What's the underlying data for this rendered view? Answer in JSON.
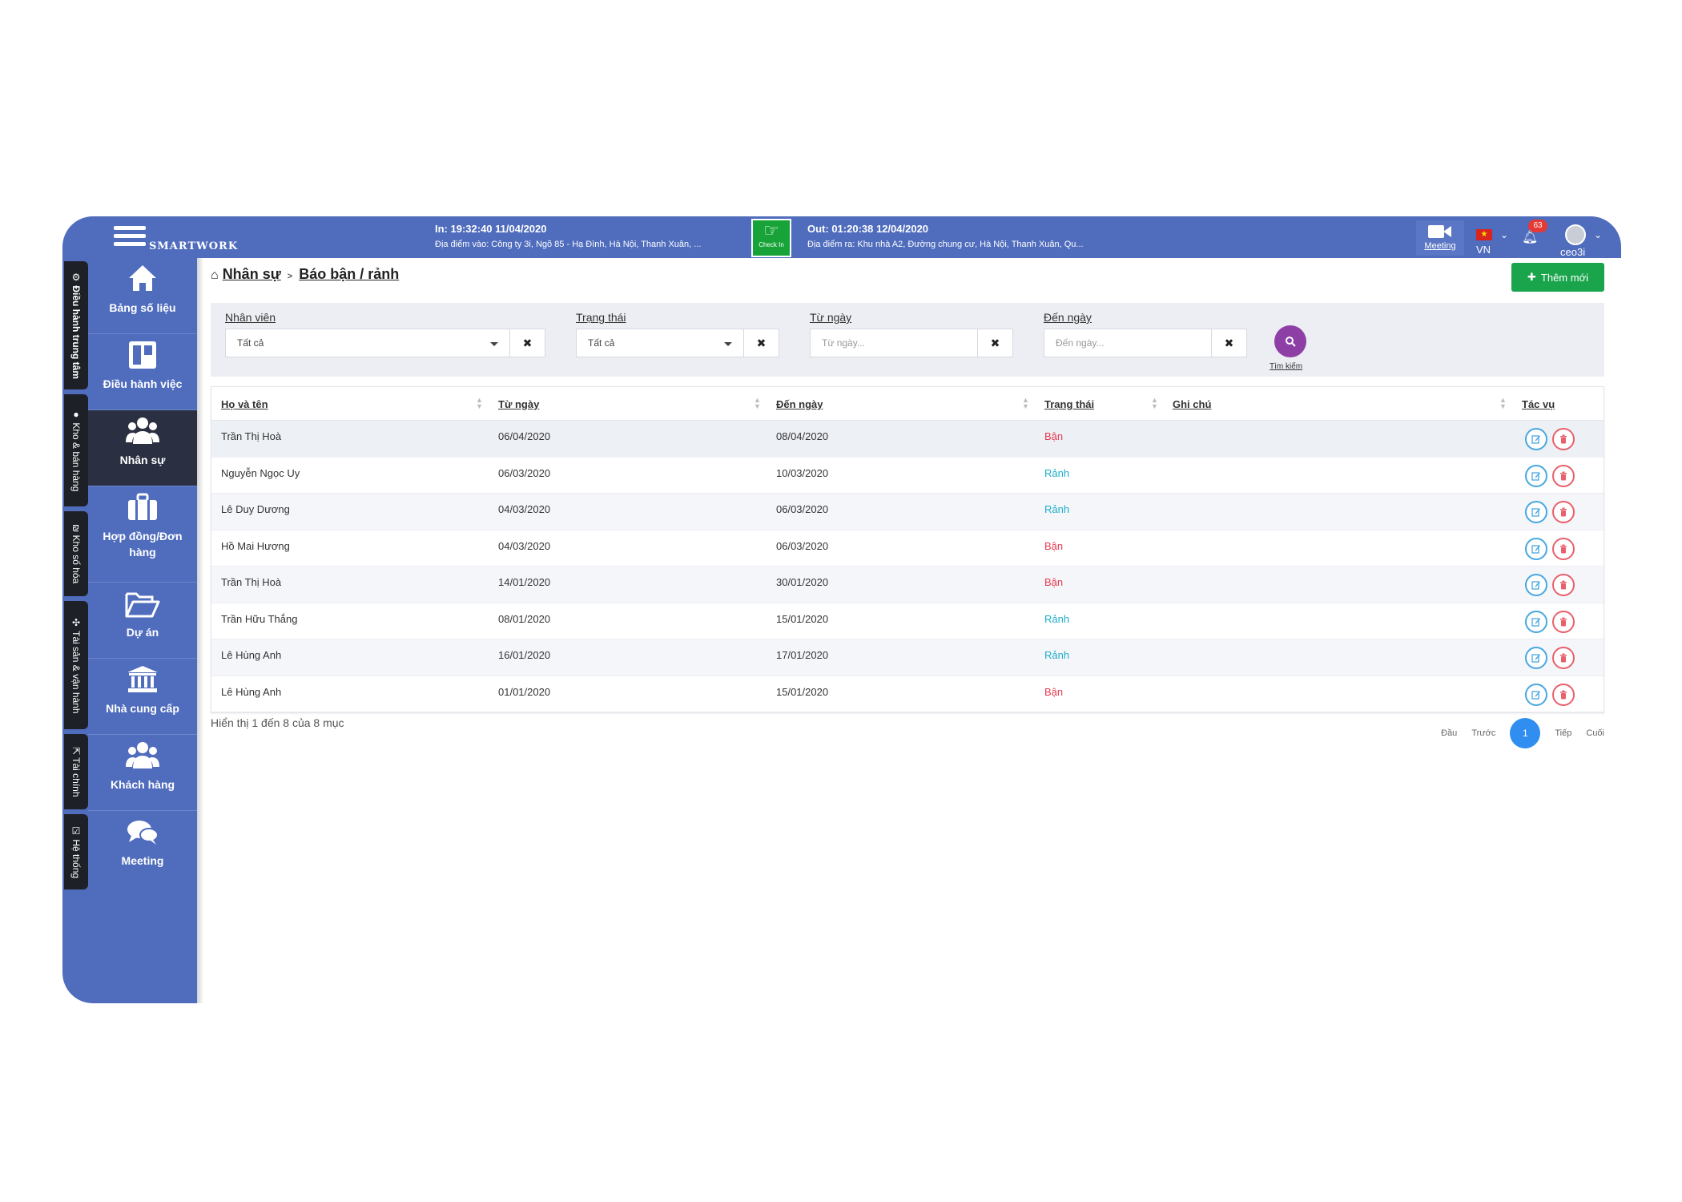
{
  "header": {
    "logo": "SMARTWORK",
    "checkin": {
      "in_time": "In: 19:32:40 11/04/2020",
      "in_location": "Địa điểm vào: Công ty 3i, Ngõ 85 - Hạ Đình, Hà Nội, Thanh Xuân, ...",
      "button_label": "Check In",
      "out_time": "Out: 01:20:38 12/04/2020",
      "out_location": "Địa điểm ra: Khu nhà A2, Đường chung cư, Hà Nội, Thanh Xuân, Qu..."
    },
    "meeting_label": "Meeting",
    "language": "VN",
    "notification_count": "63",
    "username": "ceo3i"
  },
  "modules": [
    "⚙ Điều hành trung tâm",
    "● Kho & bán hàng",
    "₪ Kho số hóa",
    "✣ Tài sản & vận hành",
    "⇱ Tài chính",
    "☑ Hệ thống"
  ],
  "sidebar": {
    "items": [
      {
        "label": "Bảng số liệu",
        "icon": "home-icon"
      },
      {
        "label": "Điều hành việc",
        "icon": "board-icon"
      },
      {
        "label": "Nhân sự",
        "icon": "users-icon"
      },
      {
        "label": "Hợp đồng/Đơn hàng",
        "icon": "briefcase-icon"
      },
      {
        "label": "Dự án",
        "icon": "folder-open-icon"
      },
      {
        "label": "Nhà cung cấp",
        "icon": "bank-icon"
      },
      {
        "label": "Khách hàng",
        "icon": "users-icon"
      },
      {
        "label": "Meeting",
        "icon": "chat-icon"
      }
    ]
  },
  "breadcrumb": {
    "parent": "Nhân sự",
    "current": "Báo bận / rảnh"
  },
  "add_button": "Thêm mới",
  "filters": {
    "employee": {
      "label": "Nhân viên",
      "value": "Tất cả"
    },
    "status": {
      "label": "Trạng thái",
      "value": "Tất cả"
    },
    "from_date": {
      "label": "Từ ngày",
      "placeholder": "Từ ngày..."
    },
    "to_date": {
      "label": "Đến ngày",
      "placeholder": "Đến ngày..."
    },
    "search_label": "Tìm kiếm"
  },
  "table": {
    "columns": [
      "Họ và tên",
      "Từ ngày",
      "Đến ngày",
      "Trạng thái",
      "Ghi chú",
      "Tác vụ"
    ],
    "rows": [
      {
        "name": "Trần Thị Hoà",
        "from": "06/04/2020",
        "to": "08/04/2020",
        "status": "Bận",
        "note": ""
      },
      {
        "name": "Nguyễn Ngọc Uy",
        "from": "06/03/2020",
        "to": "10/03/2020",
        "status": "Rảnh",
        "note": ""
      },
      {
        "name": "Lê Duy Dương",
        "from": "04/03/2020",
        "to": "06/03/2020",
        "status": "Rảnh",
        "note": ""
      },
      {
        "name": "Hồ Mai Hương",
        "from": "04/03/2020",
        "to": "06/03/2020",
        "status": "Bận",
        "note": ""
      },
      {
        "name": "Trần Thị Hoà",
        "from": "14/01/2020",
        "to": "30/01/2020",
        "status": "Bận",
        "note": ""
      },
      {
        "name": "Trần Hữu Thắng",
        "from": "08/01/2020",
        "to": "15/01/2020",
        "status": "Rảnh",
        "note": ""
      },
      {
        "name": "Lê Hùng Anh",
        "from": "16/01/2020",
        "to": "17/01/2020",
        "status": "Rảnh",
        "note": ""
      },
      {
        "name": "Lê Hùng Anh",
        "from": "01/01/2020",
        "to": "15/01/2020",
        "status": "Bận",
        "note": ""
      }
    ]
  },
  "footer": {
    "info": "Hiển thị 1 đến 8 của 8 mục",
    "pagination": {
      "first": "Đầu",
      "prev": "Trước",
      "current": "1",
      "next": "Tiếp",
      "last": "Cuối"
    }
  },
  "colors": {
    "primary": "#4f6cbd",
    "sidebar_active": "#2a3041",
    "add_button": "#1aa54d",
    "search_button": "#8e3fa6",
    "busy": "#e53950",
    "free": "#1eaec9",
    "page_active": "#2f8ef0"
  }
}
